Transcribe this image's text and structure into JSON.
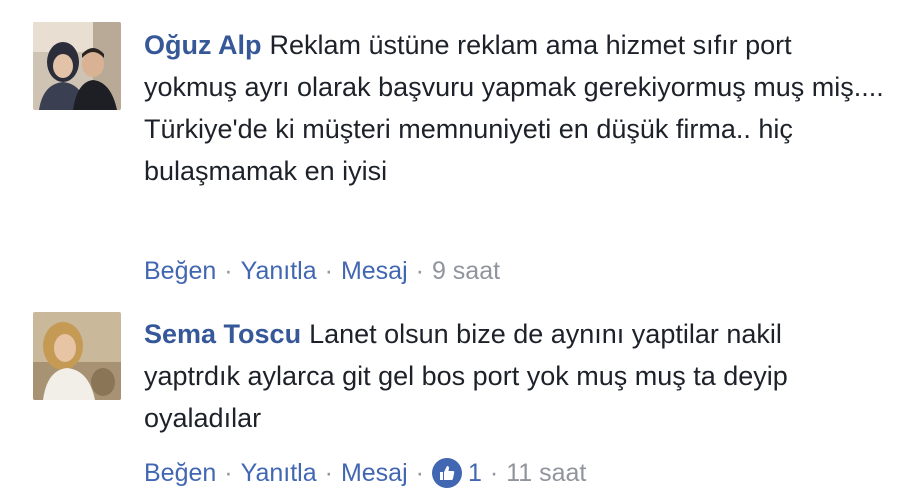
{
  "comments": [
    {
      "author": "Oğuz Alp",
      "text": "Reklam üstüne reklam ama hizmet sıfır port yokmuş ayrı olarak başvuru yapmak gerekiyormuş muş miş.... Türkiye'de ki müşteri memnuniyeti en düşük firma.. hiç bulaşmamak en iyisi",
      "actions": {
        "like": "Beğen",
        "reply": "Yanıtla",
        "message": "Mesaj"
      },
      "separator": "·",
      "time": "9 saat"
    },
    {
      "author": "Sema Toscu",
      "text": "Lanet olsun bize de aynını yaptilar nakil yaptrdık aylarca git gel bos port yok muş muş ta deyip oyaladılar",
      "actions": {
        "like": "Beğen",
        "reply": "Yanıtla",
        "message": "Mesaj"
      },
      "separator": "·",
      "reaction_count": "1",
      "reaction_icon": "thumbs-up-icon",
      "time": "11 saat"
    }
  ],
  "colors": {
    "link": "#4267b2",
    "author": "#365899",
    "meta": "#90949c",
    "text": "#1d2129"
  }
}
